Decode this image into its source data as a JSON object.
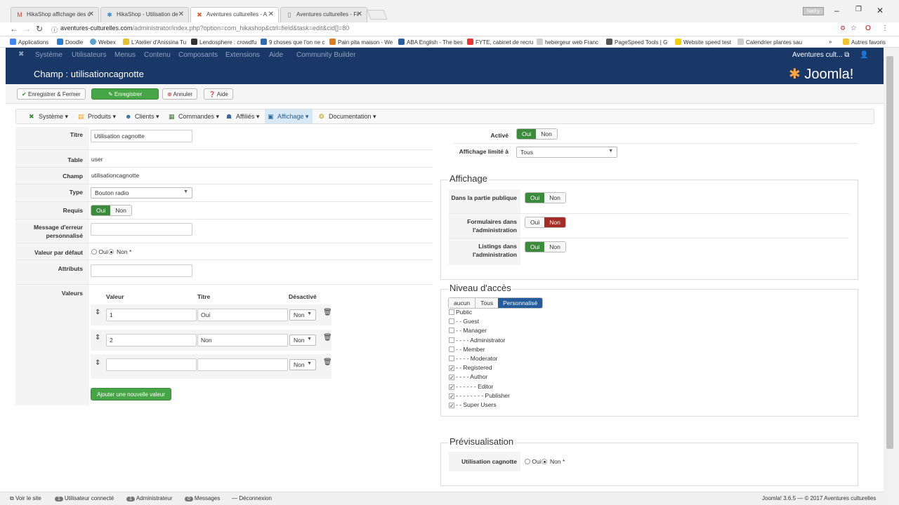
{
  "browser": {
    "tabs": [
      {
        "title": "HikaShop affichage des c",
        "icon": "gmail-icon",
        "color": "#d44638"
      },
      {
        "title": "HikaShop - Utilisation de",
        "icon": "hikashop-icon",
        "color": "#3b8ad8"
      },
      {
        "title": "Aventures culturelles - A",
        "icon": "joomla-icon",
        "color": "#e35b2c"
      },
      {
        "title": "Aventures culturelles - Fr",
        "icon": "page-icon",
        "color": "#777"
      }
    ],
    "user_badge": "Nathy",
    "url_host": "aventures-culturelles.com",
    "url_path": "/administrator/index.php?option=com_hikashop&ctrl=field&task=edit&cid[]=80",
    "bookmarks": [
      "Applications",
      "Doodle",
      "Webex",
      "L'Atelier d'Anissina Tu",
      "Lendosphere : crowdfu",
      "9 choses que l'on ne c",
      "Pain pita maison - We",
      "ABA English - The bes",
      "FYTE, cabinet de recru",
      "hebergeur web Franc",
      "PageSpeed Tools | G",
      "Website speed test",
      "Calendrier plantes sau"
    ],
    "more": "»",
    "other_bookmarks": "Autres favoris"
  },
  "joomla": {
    "menu": [
      "Système",
      "Utilisateurs",
      "Menus",
      "Contenu",
      "Composants",
      "Extensions",
      "Aide",
      "Community Builder"
    ],
    "site_name": "Aventures cult...",
    "page_title": "Champ : utilisationcagnotte",
    "logo": "Joomla!",
    "toolbar": {
      "save_close": "Enregistrer & Fermer",
      "save": "Enregistrer",
      "cancel": "Annuler",
      "help": "Aide"
    }
  },
  "hikashop_menu": [
    "Système",
    "Produits",
    "Clients",
    "Commandes",
    "Affiliés",
    "Affichage",
    "Documentation"
  ],
  "form": {
    "titre": {
      "label": "Titre",
      "value": "Utilisation cagnotte"
    },
    "table": {
      "label": "Table",
      "value": "user"
    },
    "champ": {
      "label": "Champ",
      "value": "utilisationcagnotte"
    },
    "type": {
      "label": "Type",
      "value": "Bouton radio"
    },
    "requis": {
      "label": "Requis",
      "yes": "Oui",
      "no": "Non"
    },
    "message": {
      "label": "Message d'erreur personnalisé",
      "value": ""
    },
    "defaut": {
      "label": "Valeur par défaut",
      "opt1": "Oui",
      "opt2": "Non *"
    },
    "attributs": {
      "label": "Attributs",
      "value": ""
    },
    "valeurs": {
      "label": "Valeurs",
      "headers": {
        "valeur": "Valeur",
        "titre": "Titre",
        "desactive": "Désactivé"
      },
      "rows": [
        {
          "valeur": "1",
          "titre": "Oui",
          "desactive": "Non"
        },
        {
          "valeur": "2",
          "titre": "Non",
          "desactive": "Non"
        },
        {
          "valeur": "",
          "titre": "",
          "desactive": "Non"
        }
      ],
      "add_button": "Ajouter une nouvelle valeur"
    }
  },
  "right": {
    "active": {
      "label": "Activé",
      "yes": "Oui",
      "no": "Non"
    },
    "limit": {
      "label": "Affichage limité à",
      "value": "Tous"
    },
    "affichage": {
      "legend": "Affichage",
      "public": {
        "label": "Dans la partie publique",
        "yes": "Oui",
        "no": "Non"
      },
      "forms": {
        "label": "Formulaires dans l'administration",
        "yes": "Oui",
        "no": "Non"
      },
      "listings": {
        "label": "Listings dans l'administration",
        "yes": "Oui",
        "no": "Non"
      }
    },
    "access": {
      "legend": "Niveau d'accès",
      "tabs": [
        "aucun",
        "Tous",
        "Personnalisé"
      ],
      "groups": [
        {
          "label": "Public",
          "checked": false
        },
        {
          "label": "- - Guest",
          "checked": false
        },
        {
          "label": "- - Manager",
          "checked": false
        },
        {
          "label": "- - - - Administrator",
          "checked": false
        },
        {
          "label": "- - Member",
          "checked": false
        },
        {
          "label": "- - - - Moderator",
          "checked": false
        },
        {
          "label": "- - Registered",
          "checked": true
        },
        {
          "label": "- - - - Author",
          "checked": true
        },
        {
          "label": "- - - - - - Editor",
          "checked": true
        },
        {
          "label": "- - - - - - - - Publisher",
          "checked": true
        },
        {
          "label": "- - Super Users",
          "checked": true
        }
      ]
    },
    "preview": {
      "legend": "Prévisualisation",
      "label": "Utilisation cagnotte",
      "opt1": "Oui",
      "opt2": "Non *"
    }
  },
  "status": {
    "view_site": "Voir le site",
    "users_count": "1",
    "users": "Utilisateur connecté",
    "admins_count": "1",
    "admins": "Administrateur",
    "messages_count": "0",
    "messages": "Messages",
    "logout": "Déconnexion",
    "version": "Joomla! 3.6.5 — © 2017 Aventures culturelles"
  }
}
